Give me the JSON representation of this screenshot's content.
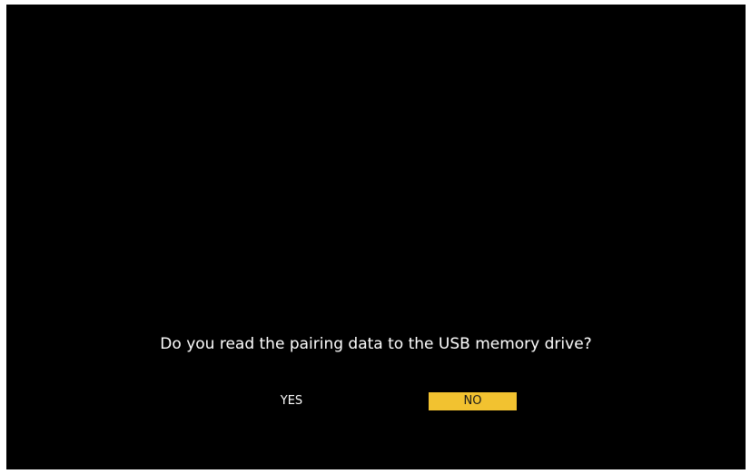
{
  "dialog": {
    "prompt": "Do you read the pairing data to the USB memory drive?",
    "options": [
      {
        "label": "YES",
        "selected": false
      },
      {
        "label": "NO",
        "selected": true
      }
    ]
  },
  "colors": {
    "screen_background": "#000000",
    "text": "#ffffff",
    "selection_highlight": "#f2c230"
  }
}
